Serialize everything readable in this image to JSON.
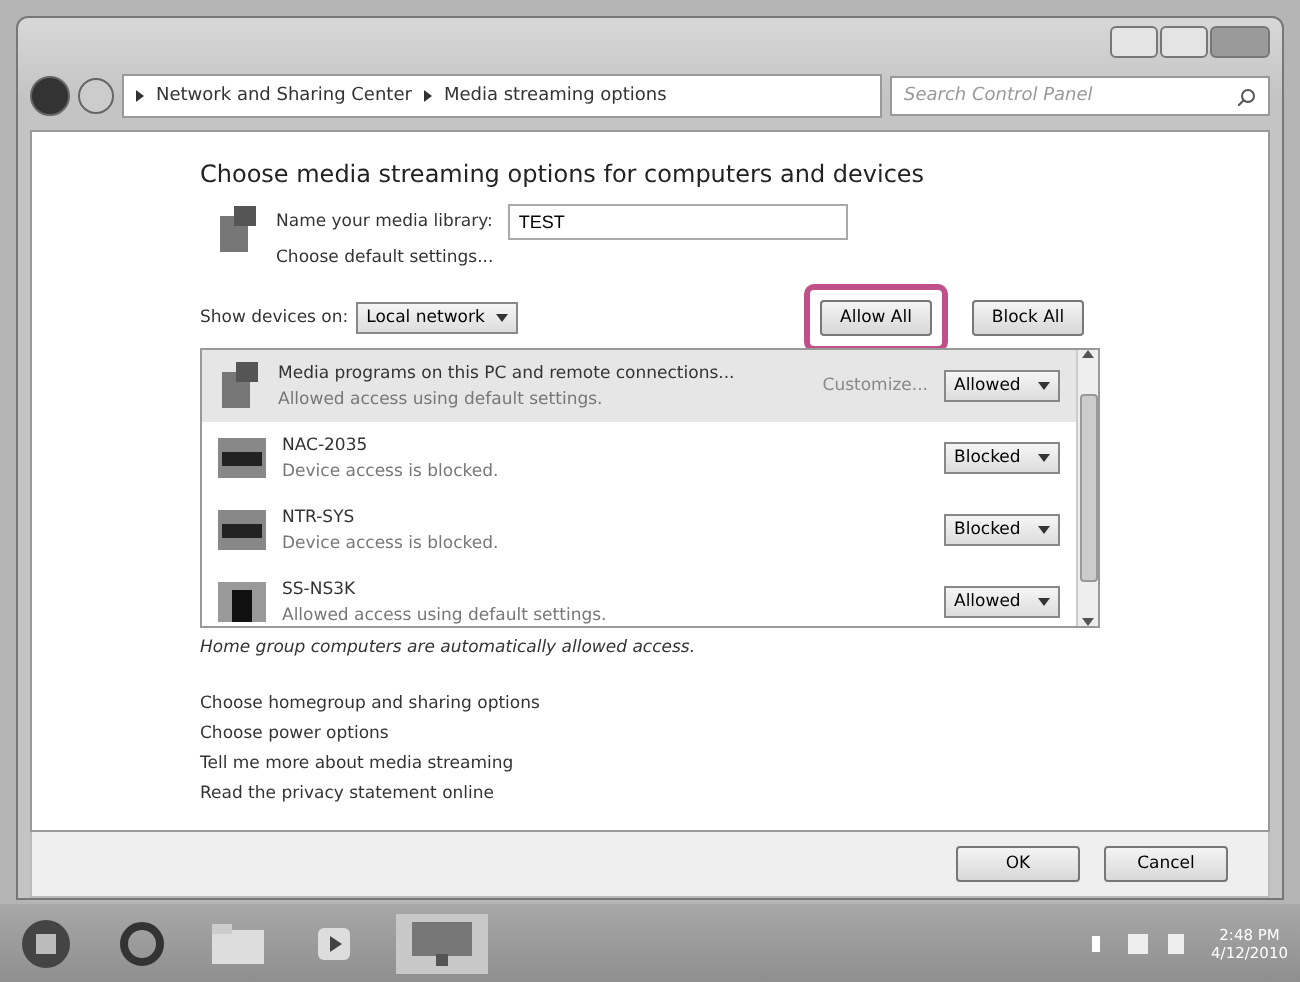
{
  "address_bar": {
    "breadcrumbs": [
      "Network and Sharing Center",
      "Media streaming options"
    ],
    "search": {
      "placeholder": "Search Control Panel"
    }
  },
  "heading": "Choose media streaming options for computers and devices",
  "library": {
    "label": "Name your media library:",
    "value": "TEST",
    "link": "Choose default settings..."
  },
  "show_devices": {
    "label": "Show devices on:",
    "value": "Local network"
  },
  "actions": [
    {
      "label": "Allow All",
      "highlighted": true
    },
    {
      "label": "Block All",
      "highlighted": false
    }
  ],
  "devices": [
    {
      "kind": "library",
      "name": "Media programs on this PC and remote connections...",
      "status": "Allowed access using default settings.",
      "link": "Customize...",
      "access": "Allowed",
      "selected": true
    },
    {
      "kind": "device",
      "name": "NAC-2035",
      "status": "Device access is blocked.",
      "access": "Blocked",
      "selected": false
    },
    {
      "kind": "device",
      "name": "NTR-SYS",
      "status": "Device access is blocked.",
      "access": "Blocked",
      "selected": false
    },
    {
      "kind": "tower",
      "name": "SS-NS3K",
      "status": "Allowed access using default settings.",
      "access": "Allowed",
      "selected": false
    }
  ],
  "note": "Home group computers are automatically allowed access.",
  "links": [
    "Choose homegroup and sharing options",
    "Choose power options",
    "Tell me more about media streaming",
    "Read the privacy statement online"
  ],
  "buttons": [
    "OK",
    "Cancel"
  ],
  "taskbar": {
    "time": "2:48 PM",
    "date": "4/12/2010"
  }
}
